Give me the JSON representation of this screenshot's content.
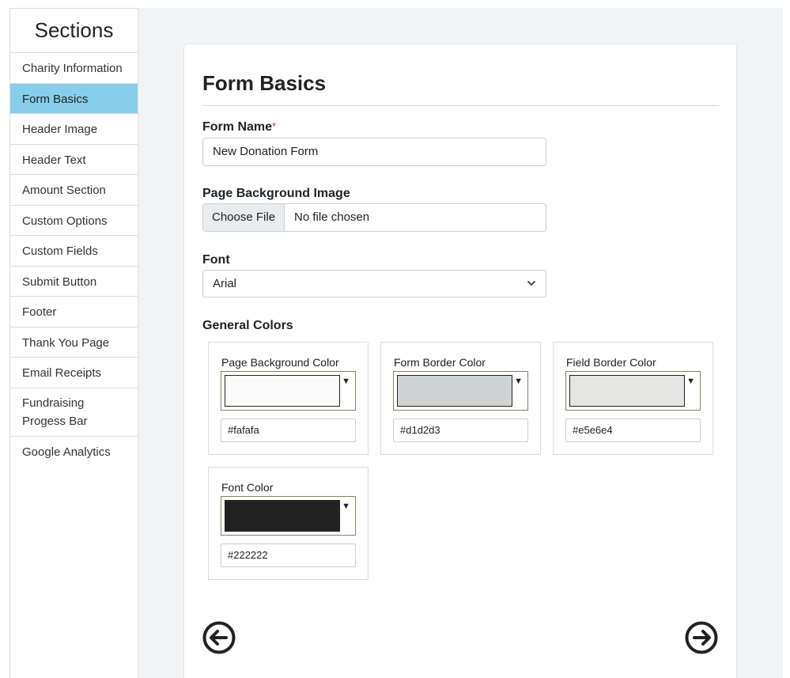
{
  "sidebar": {
    "title": "Sections",
    "items": [
      {
        "label": "Charity Information"
      },
      {
        "label": "Form Basics"
      },
      {
        "label": "Header Image"
      },
      {
        "label": "Header Text"
      },
      {
        "label": "Amount Section"
      },
      {
        "label": "Custom Options"
      },
      {
        "label": "Custom Fields"
      },
      {
        "label": "Submit Button"
      },
      {
        "label": "Footer"
      },
      {
        "label": "Thank You Page"
      },
      {
        "label": "Email Receipts"
      },
      {
        "label": "Fundraising Progess Bar"
      },
      {
        "label": "Google Analytics"
      }
    ],
    "active_index": 1,
    "active_color": "#87ceeb"
  },
  "form": {
    "title": "Form Basics",
    "form_name": {
      "label": "Form Name",
      "required_mark": "*",
      "value": "New Donation Form"
    },
    "background_image": {
      "label": "Page Background Image",
      "button_label": "Choose File",
      "status": "No file chosen"
    },
    "font": {
      "label": "Font",
      "selected": "Arial",
      "icon": "chevron-down-icon"
    },
    "general_colors": {
      "label": "General Colors",
      "items": [
        {
          "label": "Page Background Color",
          "hex": "#fafafa"
        },
        {
          "label": "Form Border Color",
          "hex": "#d1d2d3"
        },
        {
          "label": "Field Border Color",
          "hex": "#e5e6e4"
        },
        {
          "label": "Font Color",
          "hex": "#222222"
        }
      ]
    }
  },
  "navigation": {
    "prev_icon": "arrow-left-circle-icon",
    "next_icon": "arrow-right-circle-icon"
  }
}
